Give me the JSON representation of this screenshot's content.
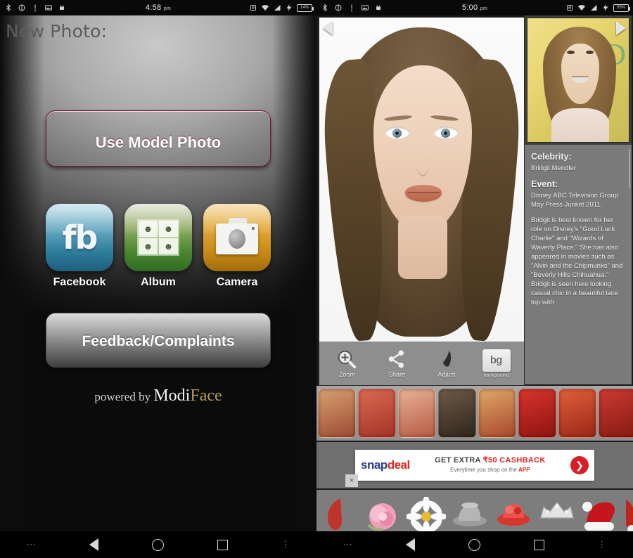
{
  "left_phone": {
    "status_bar": {
      "time": "4:58",
      "ampm": "pm",
      "battery": "14%",
      "left_icons": [
        "bluetooth-icon",
        "alarm-icon",
        "data-usage-icon",
        "screenshot-icon",
        "android-icon"
      ],
      "right_icons": [
        "screen-rotation-icon",
        "wifi-icon",
        "signal-icon",
        "charging-icon",
        "battery-icon"
      ]
    },
    "page_title": "New Photo:",
    "model_button": "Use Model Photo",
    "sources": [
      {
        "label": "Facebook",
        "glyph": "fb",
        "icon": "facebook-icon"
      },
      {
        "label": "Album",
        "glyph": "",
        "icon": "album-icon"
      },
      {
        "label": "Camera",
        "glyph": "",
        "icon": "camera-icon"
      }
    ],
    "feedback_button": "Feedback/Complaints",
    "powered_prefix": "powered by",
    "brand_first": "Modi",
    "brand_second": "Face",
    "nav": {
      "dots": "⋯",
      "back": "back-button",
      "home": "home-button",
      "recents": "recents-button",
      "kebab": "⋮"
    }
  },
  "right_phone": {
    "status_bar": {
      "time": "5:00",
      "ampm": "pm",
      "battery": "55%"
    },
    "prev_arrow": "previous-look-arrow",
    "next_arrow": "next-celebrity-arrow",
    "toolbar": [
      {
        "label": "Zoom",
        "icon": "zoom-icon"
      },
      {
        "label": "Share",
        "icon": "share-icon"
      },
      {
        "label": "Adjust",
        "icon": "adjust-brush-icon"
      },
      {
        "label": "background",
        "icon": "background-icon",
        "chip": "bg"
      }
    ],
    "info": {
      "celebrity_heading": "Celebrity:",
      "celebrity_name": "Bridgit Mendler",
      "event_heading": "Event:",
      "event_text": "Disney ABC Television Group May Press Junket 2011.",
      "bio_text": "Bridgit is best known for her role on Disney's \"Good Luck Charlie\" and \"Wizards of Waverly Place.\" She has also appeared in movies such as \"Alvin and the Chipmunks\" and \"Beverly Hills Chihuahua.\" Bridgit is seen here looking casual chic in a beautiful lace top with"
    },
    "hair_swatches": [
      {
        "name": "auburn-highlight",
        "c1": "#d8a070",
        "c2": "#9c4a33"
      },
      {
        "name": "copper-red",
        "c1": "#d96a52",
        "c2": "#a33426"
      },
      {
        "name": "strawberry-blonde",
        "c1": "#e8b394",
        "c2": "#b55a44"
      },
      {
        "name": "dark-brown",
        "c1": "#6d5a46",
        "c2": "#2f251c"
      },
      {
        "name": "golden-copper",
        "c1": "#e0a868",
        "c2": "#a8472c"
      },
      {
        "name": "bright-red",
        "c1": "#d8342e",
        "c2": "#8e140f"
      },
      {
        "name": "flame-red",
        "c1": "#e0603a",
        "c2": "#9c2616"
      },
      {
        "name": "crimson",
        "c1": "#cc3a30",
        "c2": "#861a14"
      },
      {
        "name": "deep-red",
        "c1": "#c0342c",
        "c2": "#7a120e"
      }
    ],
    "ad": {
      "brand_first": "snap",
      "brand_second": "deal",
      "line1_plain": "GET EXTRA ",
      "line1_accent": "₹50 CASHBACK",
      "line2_plain": "Everytime you shop on the ",
      "line2_accent": "APP",
      "cta": "❯",
      "close": "×"
    },
    "stickers": [
      {
        "name": "red-petal-sticker"
      },
      {
        "name": "pink-rose-sticker"
      },
      {
        "name": "white-daisy-sticker"
      },
      {
        "name": "gray-hat-sticker"
      },
      {
        "name": "red-flower-hat-sticker"
      },
      {
        "name": "silver-tiara-sticker"
      },
      {
        "name": "santa-hat-sticker"
      },
      {
        "name": "red-partial-sticker"
      }
    ]
  },
  "colors": {
    "accent_pink": "#dd1657",
    "facebook_blue": "#2f7f9e",
    "album_green": "#4f8a32",
    "camera_gold": "#e4a93c",
    "brand_gold": "#b79a57",
    "ad_red": "#e2251f"
  }
}
